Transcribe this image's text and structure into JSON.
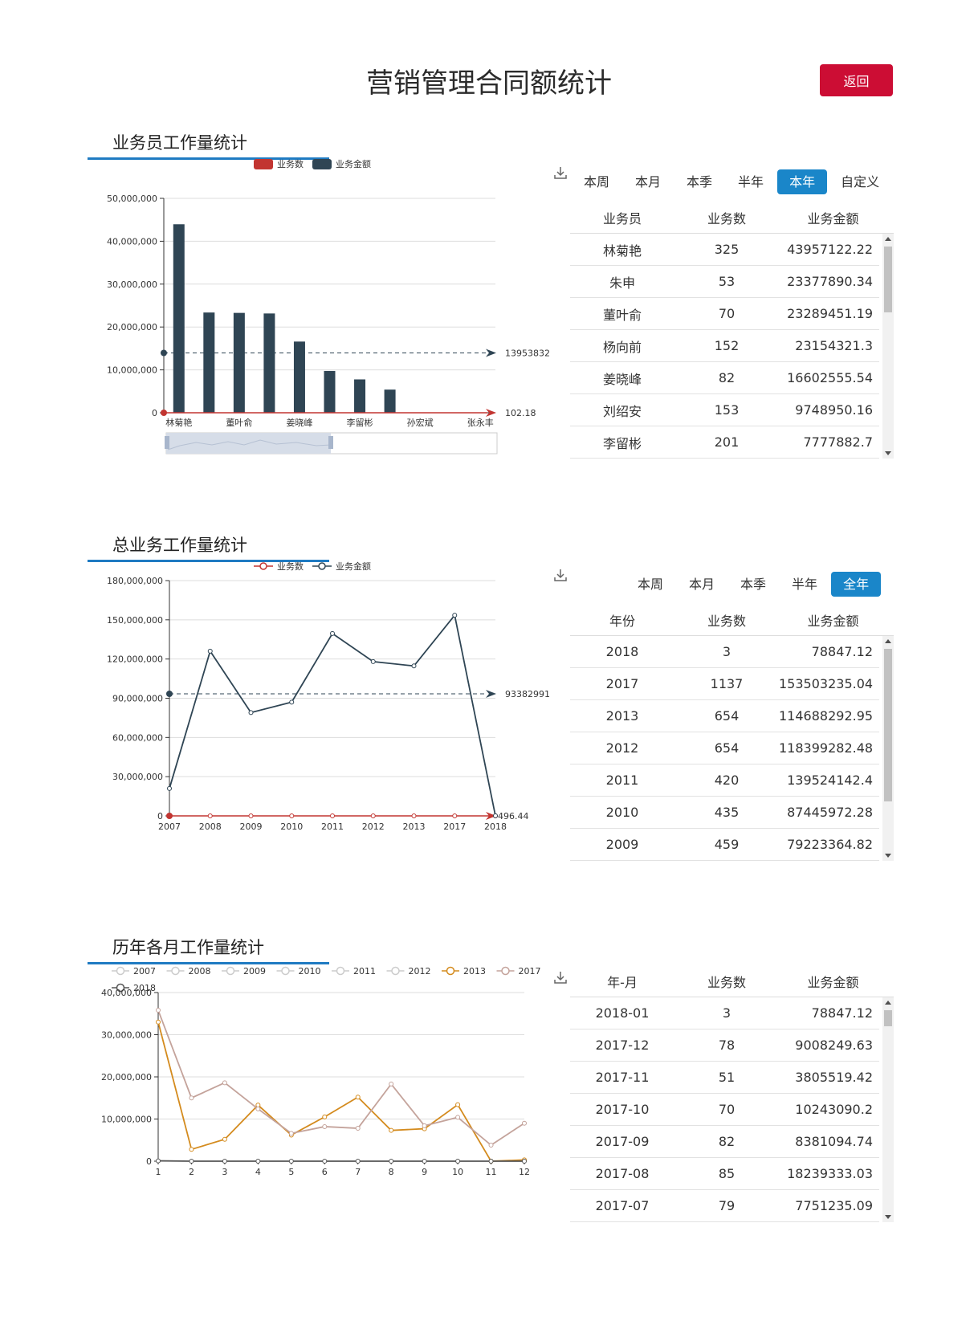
{
  "page": {
    "title": "营销管理合同额统计",
    "back_label": "返回"
  },
  "colors": {
    "count": "#c23531",
    "amount": "#2f4554",
    "y2013": "#d48b1e",
    "y2017": "#c4a39b",
    "y2018": "#555555",
    "accent_blue": "#1a86c9",
    "back_red": "#cc0d34"
  },
  "section1": {
    "title": "业务员工作量统计",
    "tabs": [
      "本周",
      "本月",
      "本季",
      "半年",
      "本年",
      "自定义"
    ],
    "active_tab": "本年",
    "table": {
      "headers": [
        "业务员",
        "业务数",
        "业务金额"
      ],
      "rows": [
        [
          "林菊艳",
          "325",
          "43957122.22"
        ],
        [
          "朱申",
          "53",
          "23377890.34"
        ],
        [
          "董叶俞",
          "70",
          "23289451.19"
        ],
        [
          "杨向前",
          "152",
          "23154321.3"
        ],
        [
          "姜晓峰",
          "82",
          "16602555.54"
        ],
        [
          "刘绍安",
          "153",
          "9748950.16"
        ],
        [
          "李留彬",
          "201",
          "7777882.7"
        ]
      ]
    }
  },
  "section2": {
    "title": "总业务工作量统计",
    "tabs": [
      "本周",
      "本月",
      "本季",
      "半年",
      "全年"
    ],
    "active_tab": "全年",
    "table": {
      "headers": [
        "年份",
        "业务数",
        "业务金额"
      ],
      "rows": [
        [
          "2018",
          "3",
          "78847.12"
        ],
        [
          "2017",
          "1137",
          "153503235.04"
        ],
        [
          "2013",
          "654",
          "114688292.95"
        ],
        [
          "2012",
          "654",
          "118399282.48"
        ],
        [
          "2011",
          "420",
          "139524142.4"
        ],
        [
          "2010",
          "435",
          "87445972.28"
        ],
        [
          "2009",
          "459",
          "79223364.82"
        ]
      ]
    }
  },
  "section3": {
    "title": "历年各月工作量统计",
    "table": {
      "headers": [
        "年-月",
        "业务数",
        "业务金额"
      ],
      "rows": [
        [
          "2018-01",
          "3",
          "78847.12"
        ],
        [
          "2017-12",
          "78",
          "9008249.63"
        ],
        [
          "2017-11",
          "51",
          "3805519.42"
        ],
        [
          "2017-10",
          "70",
          "10243090.2"
        ],
        [
          "2017-09",
          "82",
          "8381094.74"
        ],
        [
          "2017-08",
          "85",
          "18239333.03"
        ],
        [
          "2017-07",
          "79",
          "7751235.09"
        ]
      ]
    }
  },
  "chart_data": [
    {
      "type": "bar",
      "legend": [
        "业务数",
        "业务金额"
      ],
      "categories": [
        "林菊艳",
        "",
        "董叶俞",
        "",
        "姜晓峰",
        "",
        "李留彬",
        "",
        "孙宏斌",
        "",
        "张永丰"
      ],
      "series": [
        {
          "name": "业务数",
          "values": [
            325,
            53,
            70,
            152,
            82,
            153,
            201,
            0,
            0,
            0,
            0
          ]
        },
        {
          "name": "业务金额",
          "values": [
            43957122,
            23377890,
            23289451,
            23154321,
            16602556,
            9748950,
            7777883,
            5400000,
            0,
            0,
            0
          ]
        }
      ],
      "average_lines": {
        "业务金额": "13953832",
        "业务数": "102.18"
      },
      "y_ticks": [
        "0",
        "10,000,000",
        "20,000,000",
        "30,000,000",
        "40,000,000",
        "50,000,000"
      ],
      "ylim": [
        0,
        50000000
      ],
      "has_datazoom": true
    },
    {
      "type": "line",
      "legend": [
        "业务数",
        "业务金额"
      ],
      "categories": [
        "2007",
        "2008",
        "2009",
        "2010",
        "2011",
        "2012",
        "2013",
        "2017",
        "2018"
      ],
      "series": [
        {
          "name": "业务数",
          "values": [
            0,
            0,
            0,
            0,
            0,
            0,
            0,
            0,
            0
          ]
        },
        {
          "name": "业务金额",
          "values": [
            21000000,
            126000000,
            79000000,
            87000000,
            139500000,
            118000000,
            114700000,
            153500000,
            78847
          ]
        }
      ],
      "average_lines": {
        "业务金额": "93382991",
        "业务数": "496.44"
      },
      "y_ticks": [
        "0",
        "30,000,000",
        "60,000,000",
        "90,000,000",
        "120,000,000",
        "150,000,000",
        "180,000,000"
      ],
      "ylim": [
        0,
        180000000
      ]
    },
    {
      "type": "line",
      "legend": [
        "2007",
        "2008",
        "2009",
        "2010",
        "2011",
        "2012",
        "2013",
        "2017",
        "2018"
      ],
      "legend_active": [
        "2013",
        "2017",
        "2018"
      ],
      "categories": [
        "1",
        "2",
        "3",
        "4",
        "5",
        "6",
        "7",
        "8",
        "9",
        "10",
        "11",
        "12"
      ],
      "series": [
        {
          "name": "2013",
          "values": [
            33000000,
            2800000,
            5200000,
            13300000,
            6200000,
            10500000,
            15200000,
            7300000,
            7700000,
            13400000,
            0,
            300000
          ]
        },
        {
          "name": "2017",
          "values": [
            35800000,
            15000000,
            18600000,
            12400000,
            6600000,
            8200000,
            7800000,
            18300000,
            8400000,
            10400000,
            3800000,
            9000000
          ]
        },
        {
          "name": "2018",
          "values": [
            78847,
            0,
            0,
            0,
            0,
            0,
            0,
            0,
            0,
            0,
            0,
            0
          ]
        }
      ],
      "y_ticks": [
        "0",
        "10,000,000",
        "20,000,000",
        "30,000,000",
        "40,000,000"
      ],
      "ylim": [
        0,
        40000000
      ]
    }
  ]
}
